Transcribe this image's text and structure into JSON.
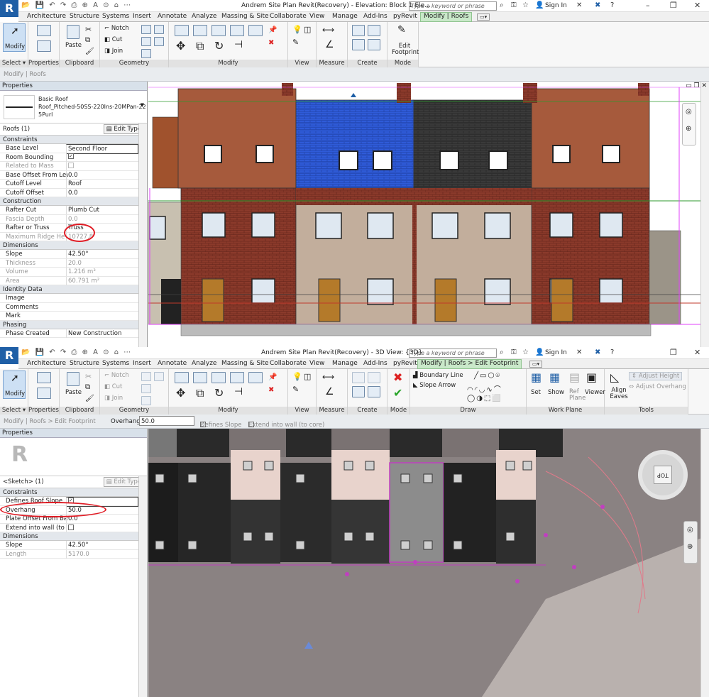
{
  "w1": {
    "title": "Andrem Site Plan Revit(Recovery) - Elevation: Block 1 Ele...",
    "search_placeholder": "Type a keyword or phrase",
    "sign_in": "Sign In",
    "tabs": [
      "Architecture",
      "Structure",
      "Systems",
      "Insert",
      "Annotate",
      "Analyze",
      "Massing & Site",
      "Collaborate",
      "View",
      "Manage",
      "Add-Ins",
      "pyRevit",
      "Modify | Roofs"
    ],
    "ribbon": {
      "modify": "Modify",
      "select": "Select ▾",
      "properties": "Properties",
      "paste": "Paste",
      "notch": "Notch",
      "cut": "Cut",
      "join": "Join",
      "edit_footprint": "Edit Footprint",
      "panels": [
        "Clipboard",
        "Geometry",
        "Modify",
        "View",
        "Measure",
        "Create",
        "Mode"
      ]
    },
    "optionbar": "Modify | Roofs",
    "props": {
      "header": "Properties",
      "type_family": "Basic Roof",
      "type_name": "Roof_Pitched-50SS-220Ins-20MPan-22",
      "type_name2": "5Purl",
      "instance": "Roofs (1)",
      "edit_type": "Edit Type",
      "groups": {
        "constraints": "Constraints",
        "construction": "Construction",
        "dimensions": "Dimensions",
        "identity": "Identity Data",
        "phasing": "Phasing"
      },
      "rows": {
        "base_level_k": "Base Level",
        "base_level_v": "Second Floor",
        "room_bounding_k": "Room Bounding",
        "related_mass_k": "Related to Mass",
        "base_offset_k": "Base Offset From Level",
        "base_offset_v": "0.0",
        "cutoff_level_k": "Cutoff Level",
        "cutoff_level_v": "Roof",
        "cutoff_offset_k": "Cutoff Offset",
        "cutoff_offset_v": "0.0",
        "rafter_cut_k": "Rafter Cut",
        "rafter_cut_v": "Plumb Cut",
        "fascia_k": "Fascia Depth",
        "fascia_v": "0.0",
        "rafter_truss_k": "Rafter or Truss",
        "rafter_truss_v": "Truss",
        "max_ridge_k": "Maximum Ridge Hei",
        "max_ridge_v": "10727.8",
        "slope_k": "Slope",
        "slope_v": "42.50°",
        "thickness_k": "Thickness",
        "thickness_v": "20.0",
        "volume_k": "Volume",
        "volume_v": "1.216 m³",
        "area_k": "Area",
        "area_v": "60.791 m²",
        "image_k": "Image",
        "comments_k": "Comments",
        "mark_k": "Mark",
        "phase_k": "Phase Created",
        "phase_v": "New Construction"
      }
    }
  },
  "w2": {
    "title": "Andrem Site Plan Revit(Recovery) - 3D View: {3D}",
    "search_placeholder": "Type a keyword or phrase",
    "sign_in": "Sign In",
    "tabs": [
      "Architecture",
      "Structure",
      "Systems",
      "Insert",
      "Annotate",
      "Analyze",
      "Massing & Site",
      "Collaborate",
      "View",
      "Manage",
      "Add-Ins",
      "pyRevit",
      "Modify | Roofs > Edit Footprint"
    ],
    "ribbon": {
      "modify": "Modify",
      "select": "Select ▾",
      "properties": "Properties",
      "paste": "Paste",
      "notch": "Notch",
      "cut": "Cut",
      "join": "Join",
      "boundary_line": "Boundary Line",
      "slope_arrow": "Slope Arrow",
      "set": "Set",
      "show": "Show",
      "ref_plane": "Ref Plane",
      "viewer": "Viewer",
      "align_eaves": "Align Eaves",
      "adjust_height": "Adjust Height",
      "adjust_overhang": "Adjust Overhang",
      "panels": [
        "Clipboard",
        "Geometry",
        "Modify",
        "View",
        "Measure",
        "Create",
        "Mode",
        "Draw",
        "Work Plane",
        "Tools"
      ]
    },
    "optionbar": {
      "breadcrumb": "Modify | Roofs > Edit Footprint",
      "overhang_label": "Overhang:",
      "overhang_value": "50.0",
      "defines_slope": "Defines Slope",
      "extend": "Extend into wall (to core)"
    },
    "props": {
      "header": "Properties",
      "instance": "<Sketch> (1)",
      "edit_type": "Edit Type",
      "groups": {
        "constraints": "Constraints",
        "dimensions": "Dimensions"
      },
      "rows": {
        "defines_k": "Defines Roof Slope",
        "overhang_k": "Overhang",
        "overhang_v": "50.0",
        "plate_k": "Plate Offset From Base",
        "plate_v": "0.0",
        "extend_k": "Extend into wall (to co...",
        "slope_k": "Slope",
        "slope_v": "42.50°",
        "length_k": "Length",
        "length_v": "5170.0"
      }
    },
    "viewcube": "TOP"
  }
}
